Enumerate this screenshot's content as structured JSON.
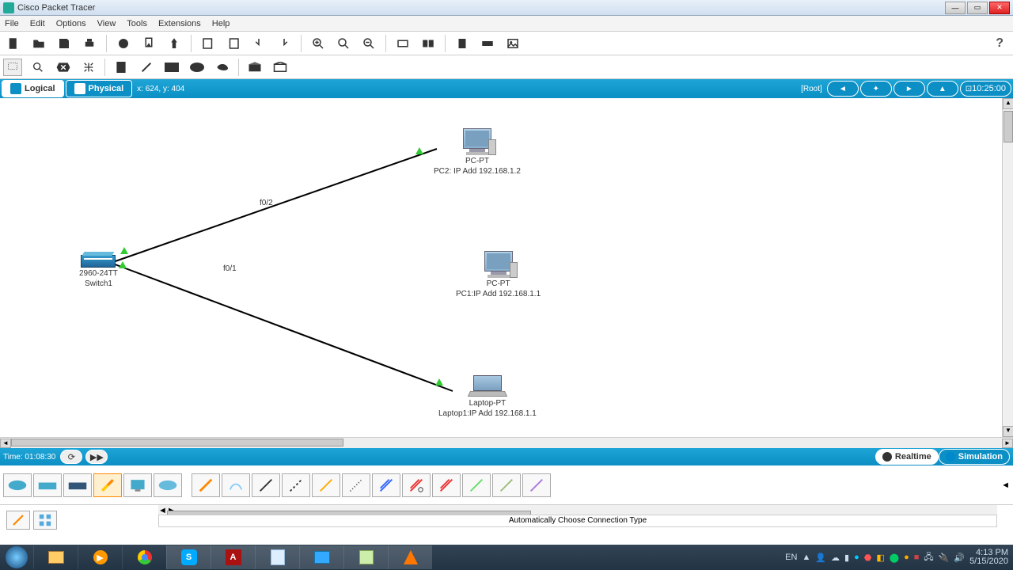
{
  "window": {
    "title": "Cisco Packet Tracer"
  },
  "menu": [
    "File",
    "Edit",
    "Options",
    "View",
    "Tools",
    "Extensions",
    "Help"
  ],
  "viewbar": {
    "logical": "Logical",
    "physical": "Physical",
    "coords": "x: 624, y: 404",
    "root": "[Root]",
    "clock": "10:25:00"
  },
  "workspace": {
    "switch": {
      "line1": "2960-24TT",
      "line2": "Switch1"
    },
    "pc2": {
      "line1": "PC-PT",
      "line2": "PC2: IP Add 192.168.1.2"
    },
    "pc1": {
      "line1": "PC-PT",
      "line2": "PC1:IP Add 192.168.1.1"
    },
    "laptop": {
      "line1": "Laptop-PT",
      "line2": "Laptop1:IP Add 192.168.1.1"
    },
    "port_f02": "f0/2",
    "port_f01": "f0/1"
  },
  "timebar": {
    "time": "Time: 01:08:30",
    "realtime": "Realtime",
    "simulation": "Simulation"
  },
  "status": "Automatically Choose Connection Type",
  "taskbar": {
    "lang": "EN",
    "time": "4:13 PM",
    "date": "5/15/2020"
  }
}
